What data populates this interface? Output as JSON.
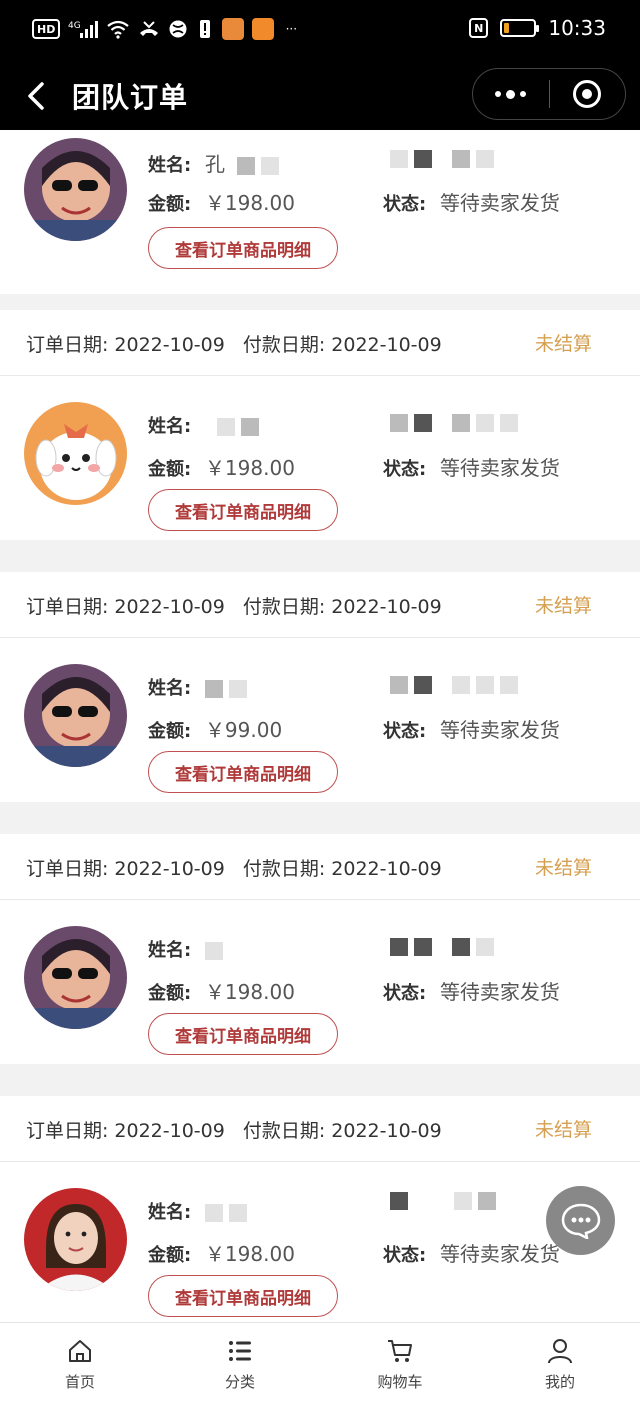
{
  "status_bar": {
    "left_icons": [
      "hd-icon",
      "4g-signal-icon",
      "wifi-icon",
      "missed-call-icon",
      "vpn-icon",
      "alert-icon",
      "app-notification-icon",
      "app-notification-icon-2",
      "more-icon"
    ],
    "hd_label": "HD",
    "net_label": "4G",
    "more_label": "···",
    "nfc_label": "N",
    "battery_level": 0.15,
    "battery_color": "#f0a020",
    "time": "10:33"
  },
  "nav": {
    "title": "团队订单"
  },
  "labels": {
    "name": "姓名:",
    "amount": "金额:",
    "status": "状态:",
    "detail_button": "查看订单商品明细"
  },
  "first_order_partial": {
    "name_visible": "孔",
    "amount": "￥198.00",
    "status": "等待卖家发货"
  },
  "orders": [
    {
      "order_date_label": "订单日期:",
      "order_date": "2022-10-09",
      "pay_date_label": "付款日期:",
      "pay_date": "2022-10-09",
      "settlement": "未结算",
      "amount": "￥198.00",
      "status": "等待卖家发货"
    },
    {
      "order_date_label": "订单日期:",
      "order_date": "2022-10-09",
      "pay_date_label": "付款日期:",
      "pay_date": "2022-10-09",
      "settlement": "未结算",
      "amount": "￥99.00",
      "status": "等待卖家发货"
    },
    {
      "order_date_label": "订单日期:",
      "order_date": "2022-10-09",
      "pay_date_label": "付款日期:",
      "pay_date": "2022-10-09",
      "settlement": "未结算",
      "amount": "￥198.00",
      "status": "等待卖家发货"
    },
    {
      "order_date_label": "订单日期:",
      "order_date": "2022-10-09",
      "pay_date_label": "付款日期:",
      "pay_date": "2022-10-09",
      "settlement": "未结算",
      "amount": "￥198.00",
      "status": "等待卖家发货"
    }
  ],
  "colors": {
    "settle_accent": "#d6a052",
    "button_border": "#c05050",
    "button_text": "#b03a3a"
  },
  "tabbar": {
    "items": [
      {
        "label": "首页",
        "icon": "home-icon"
      },
      {
        "label": "分类",
        "icon": "category-list-icon"
      },
      {
        "label": "购物车",
        "icon": "cart-icon"
      },
      {
        "label": "我的",
        "icon": "user-icon"
      }
    ]
  }
}
